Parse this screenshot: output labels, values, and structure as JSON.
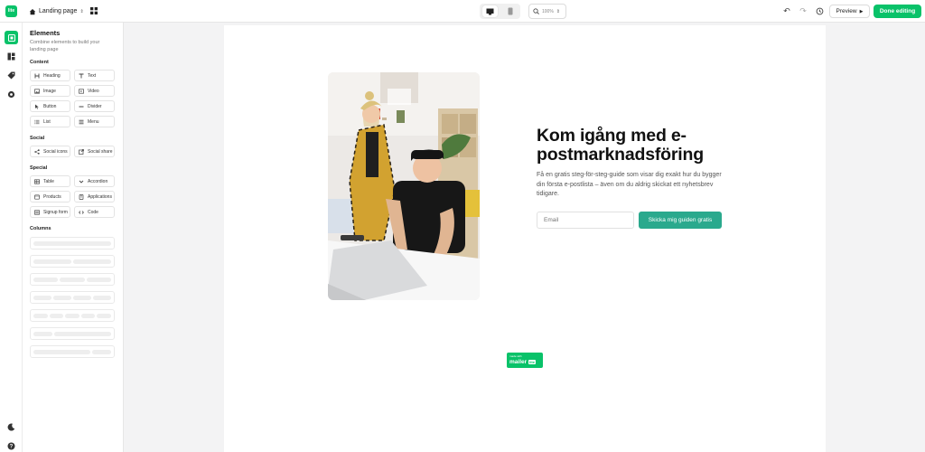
{
  "app": {
    "logo_text": "lite",
    "page_name": "Landing page",
    "zoom": "100%",
    "preview_label": "Preview",
    "done_label": "Done editing",
    "accent_color": "#09c269"
  },
  "rail": {
    "icons": [
      "elements-icon",
      "layout-icon",
      "tag-icon",
      "settings-icon",
      "theme-icon",
      "help-icon"
    ]
  },
  "panel": {
    "title": "Elements",
    "subtitle": "Combine elements to build your landing page",
    "content_title": "Content",
    "content_items": [
      {
        "label": "Heading",
        "icon": "heading-icon"
      },
      {
        "label": "Text",
        "icon": "text-icon"
      },
      {
        "label": "Image",
        "icon": "image-icon"
      },
      {
        "label": "Video",
        "icon": "video-icon"
      },
      {
        "label": "Button",
        "icon": "cursor-icon"
      },
      {
        "label": "Divider",
        "icon": "divider-icon"
      },
      {
        "label": "List",
        "icon": "list-icon"
      },
      {
        "label": "Menu",
        "icon": "menu-icon"
      }
    ],
    "social_title": "Social",
    "social_items": [
      {
        "label": "Social icons",
        "icon": "share-nodes-icon"
      },
      {
        "label": "Social share",
        "icon": "external-share-icon"
      }
    ],
    "special_title": "Special",
    "special_items": [
      {
        "label": "Table",
        "icon": "table-icon"
      },
      {
        "label": "Accordion",
        "icon": "chevron-down-icon"
      },
      {
        "label": "Products",
        "icon": "products-icon"
      },
      {
        "label": "Applications",
        "icon": "applications-icon"
      },
      {
        "label": "Signup form",
        "icon": "form-icon"
      },
      {
        "label": "Code",
        "icon": "code-icon"
      }
    ],
    "columns_title": "Columns",
    "column_layouts": [
      1,
      2,
      3,
      4,
      5,
      2,
      2
    ]
  },
  "hero": {
    "title": "Kom igång med e-postmarknadsföring",
    "text": "Få en gratis steg-för-steg-guide som visar dig exakt hur du bygger din första e-postlista – även om du aldrig skickat ett nyhetsbrev tidigare.",
    "email_placeholder": "Email",
    "cta_label": "Skicka mig guiden gratis",
    "cta_color": "#2aa98d"
  },
  "badge": {
    "small_text": "made with",
    "brand": "mailer",
    "lite": "lite"
  }
}
